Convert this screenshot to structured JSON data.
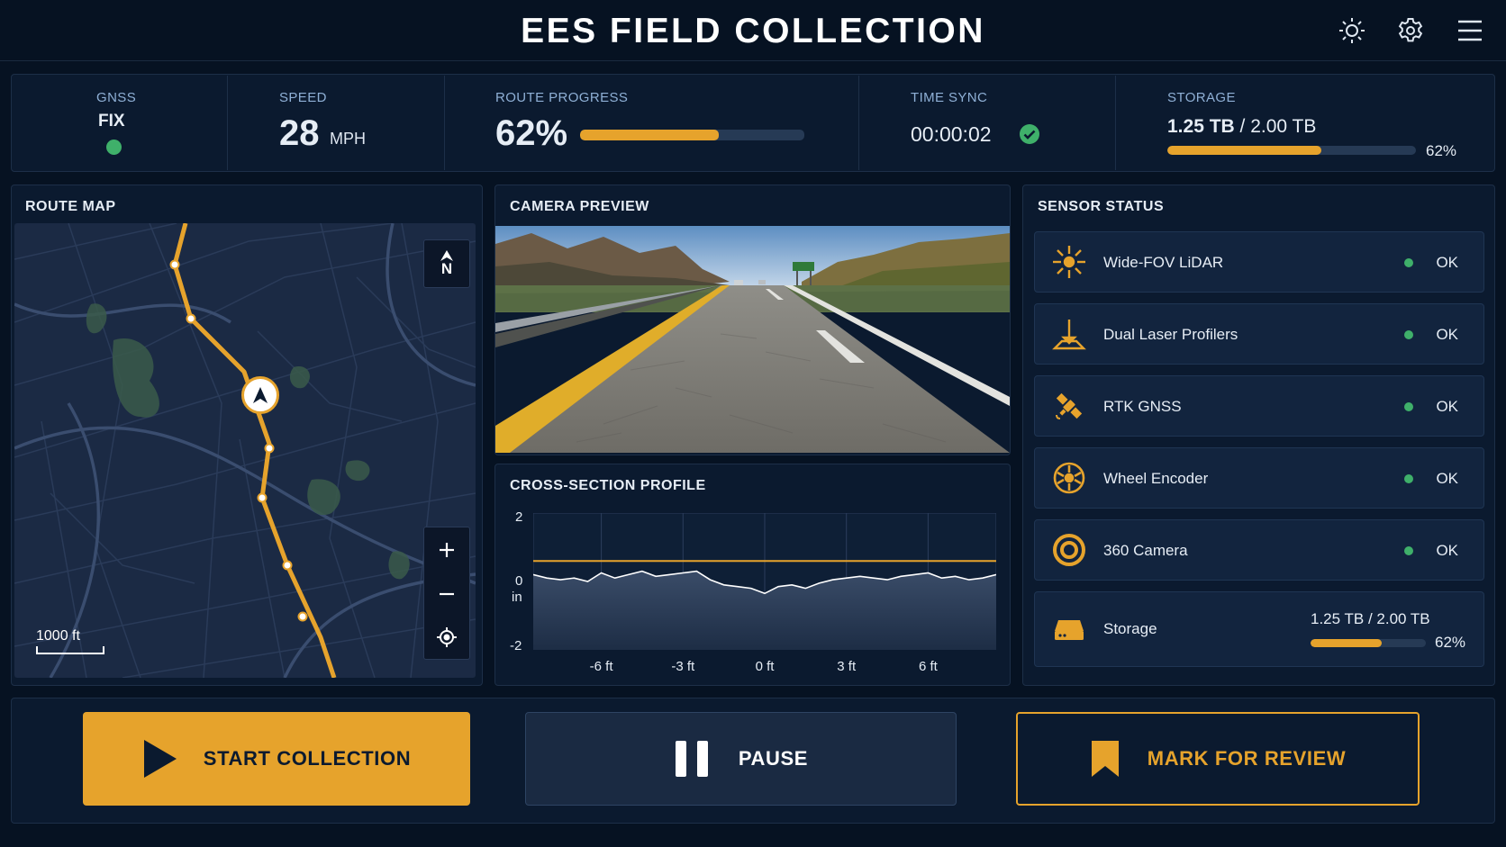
{
  "header": {
    "title": "EES FIELD COLLECTION",
    "icons": [
      "brightness-icon",
      "settings-gear-icon",
      "hamburger-menu-icon"
    ]
  },
  "status_bar": {
    "gnss": {
      "label": "GNSS",
      "value": "FIX",
      "status_color": "#3fb06a"
    },
    "speed": {
      "label": "SPEED",
      "value": "28",
      "unit": "MPH"
    },
    "route_progress": {
      "label": "ROUTE PROGRESS",
      "value": "62%",
      "progress": 0.62
    },
    "time_sync": {
      "label": "TIME SYNC",
      "value": "00:00:02",
      "status_color": "#3fb06a"
    },
    "storage": {
      "label": "STORAGE",
      "used": "1.25 TB",
      "separator": "/",
      "total": "2.00 TB",
      "percent": "62%",
      "progress": 0.62
    }
  },
  "route_map": {
    "title": "ROUTE MAP",
    "compass_label": "N",
    "scale_label": "1000 ft",
    "controls": [
      "zoom-in-icon",
      "zoom-out-icon",
      "locate-icon"
    ]
  },
  "camera_preview": {
    "title": "CAMERA PREVIEW"
  },
  "cross_section": {
    "title": "CROSS-SECTION PROFILE",
    "y_ticks": [
      "2",
      "0",
      "-2"
    ],
    "y_unit": "in",
    "x_ticks": [
      "-6 ft",
      "-3 ft",
      "0 ft",
      "3 ft",
      "6 ft"
    ]
  },
  "sensor_status": {
    "title": "SENSOR STATUS",
    "items": [
      {
        "name": "Wide-FOV LiDAR",
        "status": "OK",
        "icon": "lidar-burst-icon"
      },
      {
        "name": "Dual Laser Profilers",
        "status": "OK",
        "icon": "laser-profiler-icon"
      },
      {
        "name": "RTK GNSS",
        "status": "OK",
        "icon": "satellite-icon"
      },
      {
        "name": "Wheel Encoder",
        "status": "OK",
        "icon": "wheel-icon"
      },
      {
        "name": "360 Camera",
        "status": "OK",
        "icon": "camera-lens-icon"
      }
    ],
    "storage": {
      "name": "Storage",
      "value": "1.25 TB / 2.00 TB",
      "percent": "62%",
      "progress": 0.62,
      "icon": "hard-drive-icon"
    }
  },
  "actions": {
    "start": "START COLLECTION",
    "pause": "PAUSE",
    "mark": "MARK FOR REVIEW"
  },
  "colors": {
    "accent": "#e6a32c",
    "ok": "#3fb06a",
    "background": "#061222",
    "panel": "#0b1a2f"
  },
  "chart_data": {
    "type": "line",
    "title": "CROSS-SECTION PROFILE",
    "xlabel": "",
    "ylabel": "in",
    "xlim": [
      -8.5,
      8.5
    ],
    "ylim": [
      -2,
      2
    ],
    "x_ticks": [
      -6,
      -3,
      0,
      3,
      6
    ],
    "y_ticks": [
      -2,
      0,
      2
    ],
    "series": [
      {
        "x": [
          -8.5,
          -8,
          -7.5,
          -7,
          -6.5,
          -6,
          -5.5,
          -5,
          -4.5,
          -4,
          -3.5,
          -3,
          -2.5,
          -2,
          -1.5,
          -1,
          -0.5,
          0,
          0.5,
          1,
          1.5,
          2,
          2.5,
          3,
          3.5,
          4,
          4.5,
          5,
          5.5,
          6,
          6.5,
          7,
          7.5,
          8,
          8.5
        ],
        "y": [
          0.2,
          0.1,
          0.05,
          0.1,
          0.0,
          0.25,
          0.1,
          0.2,
          0.3,
          0.15,
          0.2,
          0.25,
          0.3,
          0.05,
          -0.1,
          -0.15,
          -0.2,
          -0.35,
          -0.15,
          -0.1,
          -0.2,
          -0.05,
          0.05,
          0.1,
          0.15,
          0.1,
          0.05,
          0.15,
          0.2,
          0.25,
          0.1,
          0.15,
          0.05,
          0.1,
          0.2
        ]
      },
      {
        "x": [
          -8.5,
          8.5
        ],
        "y": [
          0.6,
          0.6
        ]
      }
    ],
    "grid": true
  }
}
